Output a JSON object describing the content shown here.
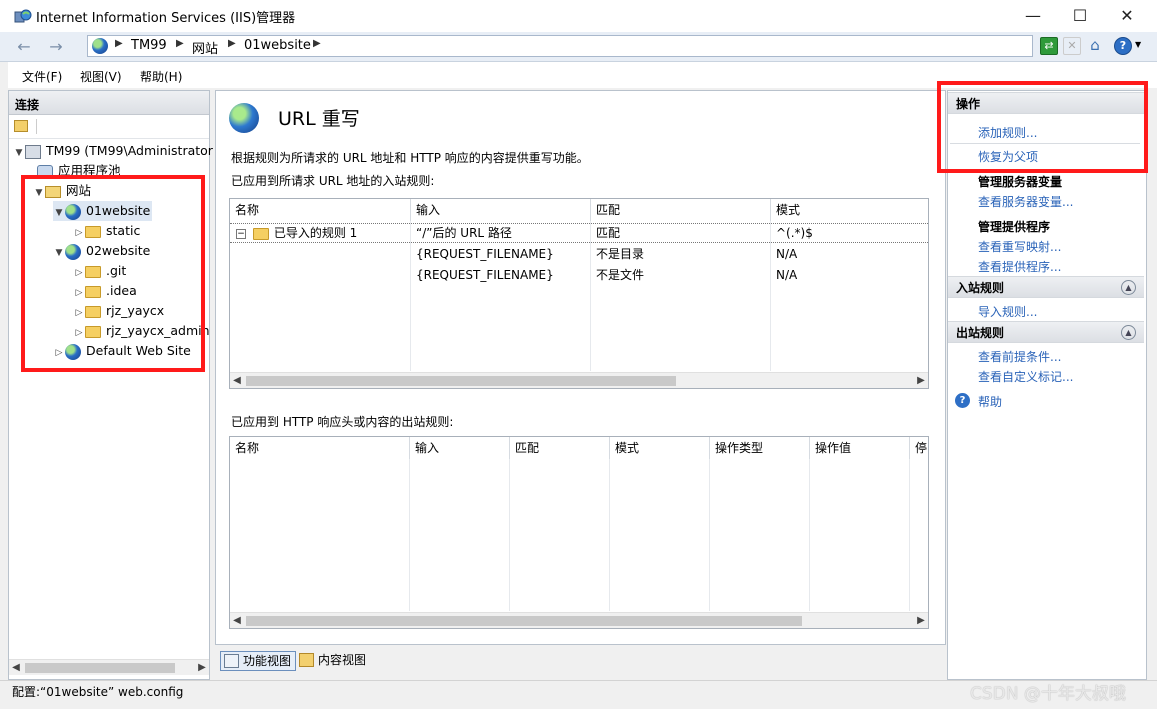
{
  "window": {
    "title": "Internet Information Services (IIS)管理器",
    "minimize": "—",
    "maximize": "☐",
    "close": "✕"
  },
  "address": {
    "crumbs": [
      "TM99",
      "网站",
      "01website"
    ]
  },
  "menu": [
    "文件(F)",
    "视图(V)",
    "帮助(H)"
  ],
  "connections": {
    "header": "连接",
    "tree": {
      "server": "TM99 (TM99\\Administrator",
      "app_pools": "应用程序池",
      "sites": "网站",
      "site1": "01website",
      "site1_child": "static",
      "site2": "02website",
      "site2_children": [
        ".git",
        ".idea",
        "rjz_yaycx",
        "rjz_yaycx_admin"
      ],
      "default_site": "Default Web Site"
    }
  },
  "feature": {
    "title": "URL 重写",
    "description": "根据规则为所请求的 URL 地址和 HTTP 响应的内容提供重写功能。",
    "inbound_label": "已应用到所请求 URL 地址的入站规则:",
    "inbound_columns": [
      "名称",
      "输入",
      "匹配",
      "模式"
    ],
    "inbound_rule": {
      "name": "已导入的规则 1",
      "input": "“/”后的 URL 路径",
      "match": "匹配",
      "pattern": "^(.*)$"
    },
    "conditions": [
      {
        "input": "{REQUEST_FILENAME}",
        "match": "不是目录",
        "pattern": "N/A"
      },
      {
        "input": "{REQUEST_FILENAME}",
        "match": "不是文件",
        "pattern": "N/A"
      }
    ],
    "outbound_label": "已应用到 HTTP 响应头或内容的出站规则:",
    "outbound_columns": [
      "名称",
      "输入",
      "匹配",
      "模式",
      "操作类型",
      "操作值",
      "停"
    ]
  },
  "views": {
    "features": "功能视图",
    "content": "内容视图"
  },
  "actions": {
    "header": "操作",
    "add_rule": "添加规则...",
    "revert_parent": "恢复为父项",
    "server_vars_title": "管理服务器变量",
    "view_server_vars": "查看服务器变量...",
    "providers_title": "管理提供程序",
    "view_rewrite_maps": "查看重写映射...",
    "view_providers": "查看提供程序...",
    "inbound_header": "入站规则",
    "import_rules": "导入规则...",
    "outbound_header": "出站规则",
    "view_preconditions": "查看前提条件...",
    "view_custom_tags": "查看自定义标记...",
    "help": "帮助"
  },
  "status": "配置:“01website” web.config",
  "watermark": "CSDN @十年大叔哦",
  "colors": {
    "highlight_red": "#ff1a1a",
    "link_blue": "#2a63b8"
  }
}
